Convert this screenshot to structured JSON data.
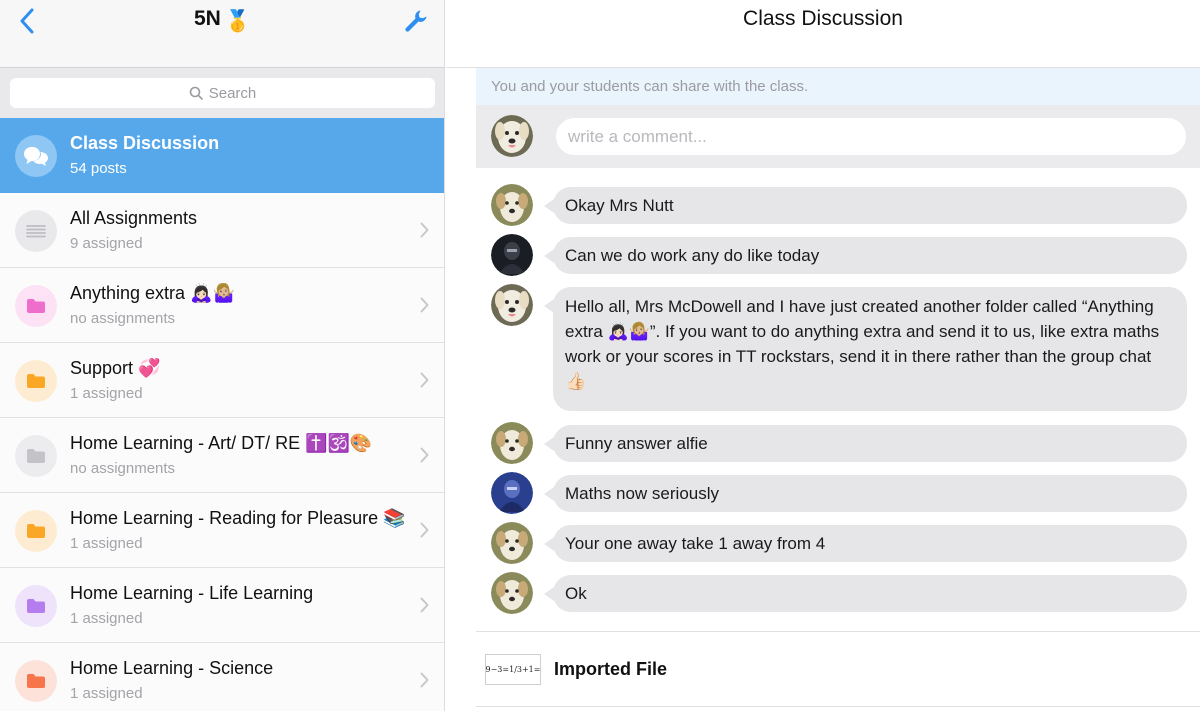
{
  "sidebar": {
    "title": "5N",
    "title_emoji": "🥇",
    "search_placeholder": "Search",
    "items": [
      {
        "name": "Class Discussion",
        "sub": "54 posts",
        "icon": "chat-bubbles-icon",
        "color": "#8ec6f4",
        "active": true
      },
      {
        "name": "All Assignments",
        "sub": "9 assigned",
        "icon": "list-icon",
        "color": "#e9e9ec"
      },
      {
        "name": "Anything extra 🙇🏻‍♀️🤷🏼‍♀️",
        "sub": "no assignments",
        "icon": "folder-icon",
        "color": "#f06ecb"
      },
      {
        "name": "Support 💞",
        "sub": "1 assigned",
        "icon": "folder-icon",
        "color": "#fba726"
      },
      {
        "name": "Home Learning - Art/ DT/ RE ✝️🕉️🎨",
        "sub": "no assignments",
        "icon": "folder-icon",
        "color": "#c4c4c8"
      },
      {
        "name": "Home Learning - Reading for Pleasure 📚",
        "sub": "1 assigned",
        "icon": "folder-icon",
        "color": "#fba726"
      },
      {
        "name": "Home Learning - Life Learning",
        "sub": "1 assigned",
        "icon": "folder-icon",
        "color": "#b57cf0"
      },
      {
        "name": "Home Learning - Science",
        "sub": "1 assigned",
        "icon": "folder-icon",
        "color": "#f7754a"
      }
    ]
  },
  "main": {
    "title": "Class Discussion",
    "info": "You and your students can share with the class.",
    "comment_placeholder": "write a comment...",
    "messages": [
      {
        "text": "Okay  Mrs Nutt",
        "avatar": "dog-avatar-icon"
      },
      {
        "text": "Can we do work any do like today",
        "avatar": "player-avatar-icon"
      },
      {
        "text": "Hello all, Mrs McDowell and I have just created another folder called “Anything extra 🙇🏻‍♀️🤷🏼‍♀️”. If you want to do anything extra and send it to us, like extra maths work or your scores in TT rockstars, send it in there rather than the group chat 👍🏻",
        "avatar": "teacher-dog-avatar-icon"
      },
      {
        "text": "Funny answer alfie",
        "avatar": "dog-avatar-icon"
      },
      {
        "text": "Maths now seriously",
        "avatar": "player-avatar-icon"
      },
      {
        "text": "Your one away take  1 away from 4",
        "avatar": "dog-avatar-icon"
      },
      {
        "text": "Ok",
        "avatar": "dog-avatar-icon"
      }
    ],
    "file": {
      "name": "Imported File",
      "thumb_text": "9−3=1/3+1="
    }
  },
  "colors": {
    "accent": "#56a8ea",
    "bubble": "#e6e6e9",
    "info_bar": "#eaf4fc"
  }
}
